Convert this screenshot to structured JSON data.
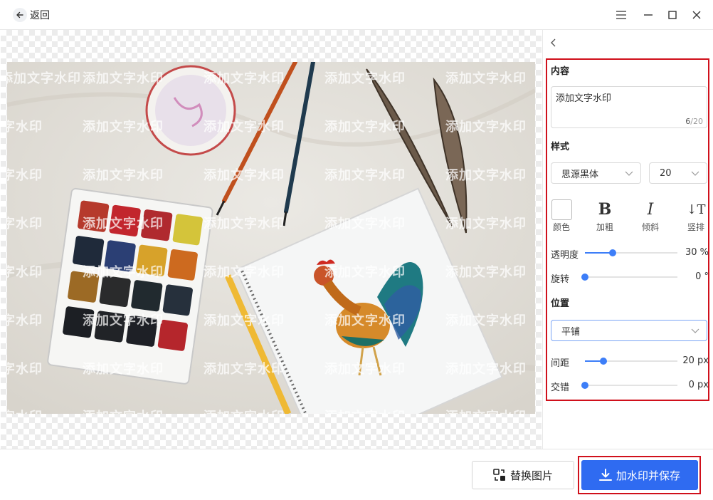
{
  "titlebar": {
    "back_label": "返回"
  },
  "watermark": {
    "text": "添加文字水印"
  },
  "panel": {
    "content_title": "内容",
    "content_text": "添加文字水印",
    "counter_current": "6",
    "counter_sep": "/",
    "counter_max": "20",
    "style_title": "样式",
    "font_family": "思源黑体",
    "font_size": "20",
    "style_buttons": {
      "color": "颜色",
      "bold_glyph": "B",
      "bold": "加粗",
      "italic_glyph": "I",
      "italic": "倾斜",
      "vertical_glyph": "↓T",
      "vertical": "竖排"
    },
    "opacity": {
      "label": "透明度",
      "value": 30,
      "display": "30 %"
    },
    "rotation": {
      "label": "旋转",
      "value": 0,
      "display": "0 °"
    },
    "position_title": "位置",
    "position_mode": "平铺",
    "spacing": {
      "label": "间距",
      "value": 20,
      "display": "20 px"
    },
    "stagger": {
      "label": "交错",
      "value": 0,
      "display": "0 px"
    }
  },
  "footer": {
    "replace_label": "替换图片",
    "save_label": "加水印并保存"
  },
  "colors": {
    "accent": "#2f6bf1",
    "slider": "#3d7ef8",
    "highlight_border": "#d0101b"
  },
  "icons": [
    "back-arrow-icon",
    "menu-icon",
    "minimize-icon",
    "maximize-icon",
    "close-icon",
    "chevron-left-icon",
    "chevron-down-icon",
    "replace-image-icon",
    "download-icon"
  ]
}
